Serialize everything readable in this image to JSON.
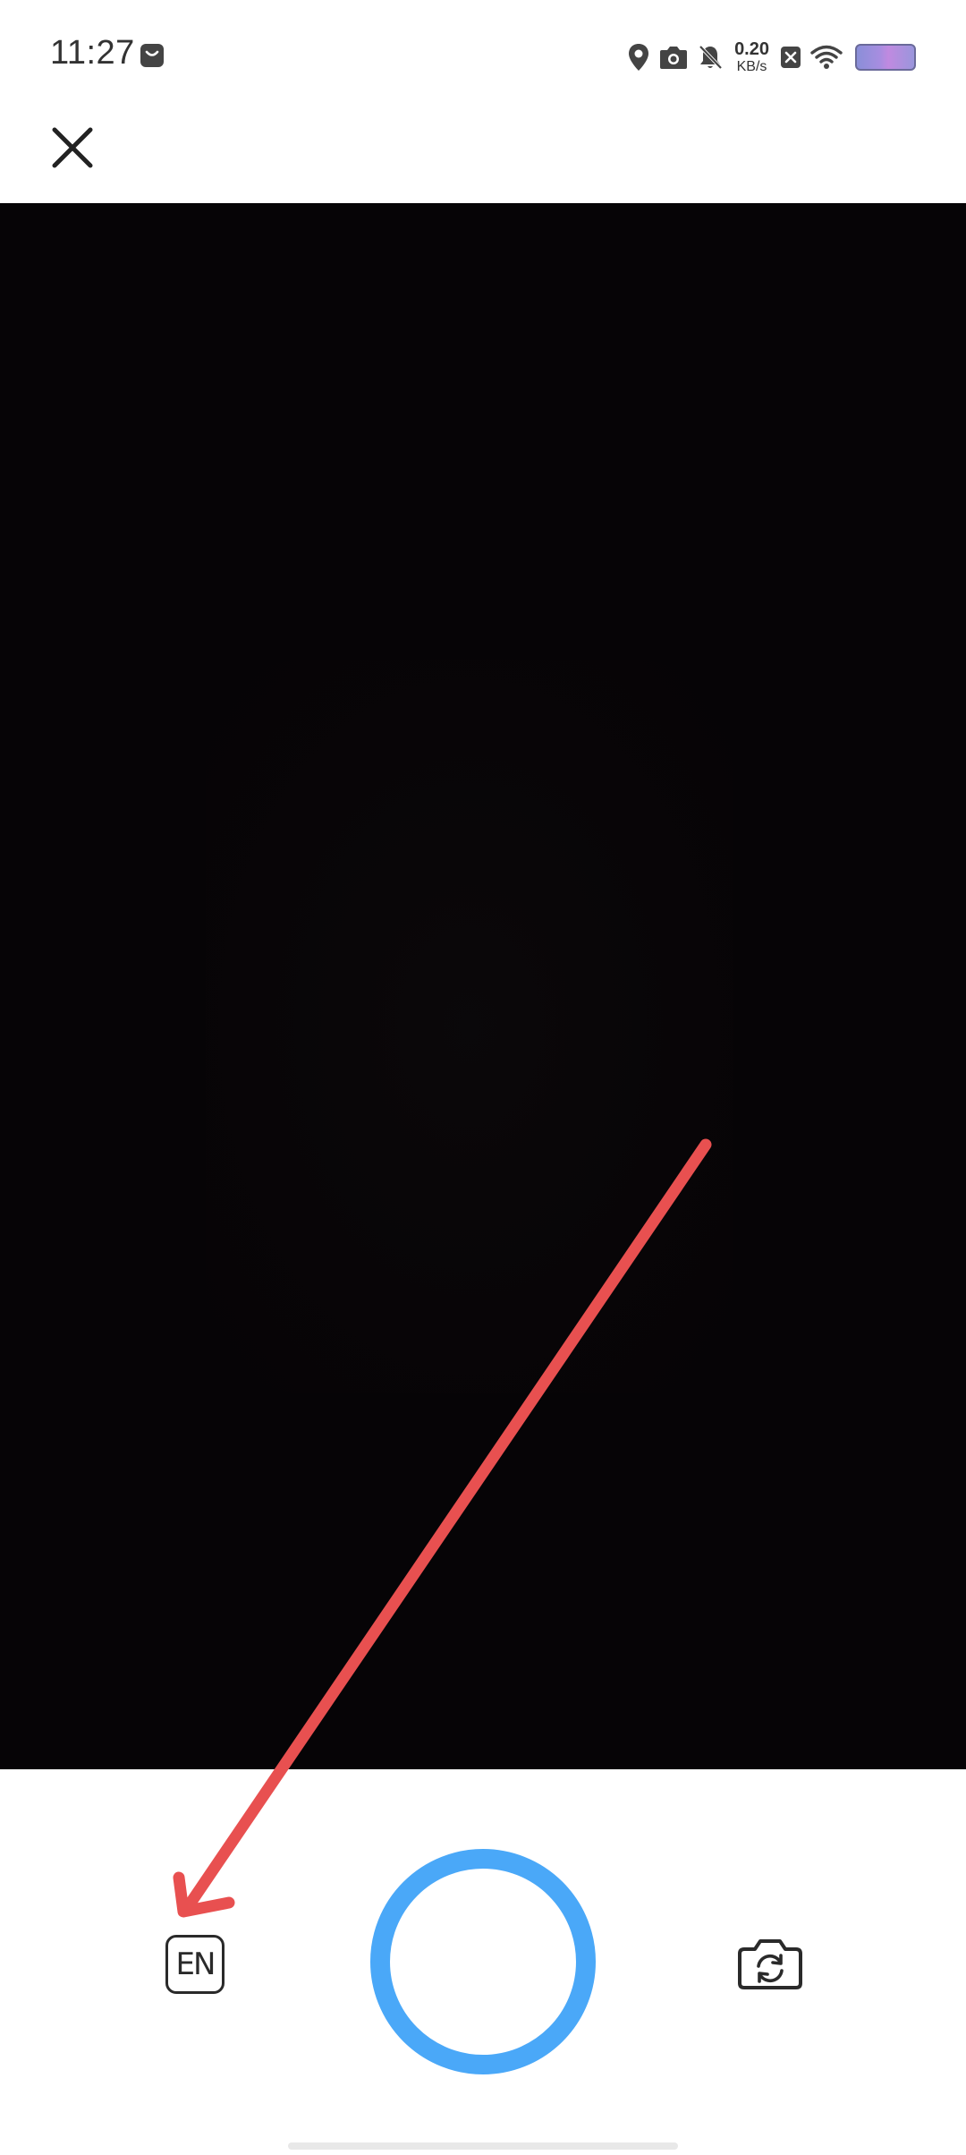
{
  "status_bar": {
    "time": "11:27",
    "net_speed_value": "0.20",
    "net_speed_unit": "KB/s",
    "icons": [
      "bag-icon",
      "location-icon",
      "camera-icon",
      "bell-muted-icon",
      "close-box-icon",
      "wifi-icon",
      "battery-icon"
    ]
  },
  "top_bar": {
    "close_icon": "close-icon"
  },
  "controls": {
    "language_toggle_label": "EN",
    "shutter_icon": "shutter-ring",
    "flip_icon": "camera-flip-icon"
  },
  "colors": {
    "preview_bg": "#060406",
    "shutter_ring": "#4aa8f8",
    "annotation_arrow": "#e85050"
  }
}
